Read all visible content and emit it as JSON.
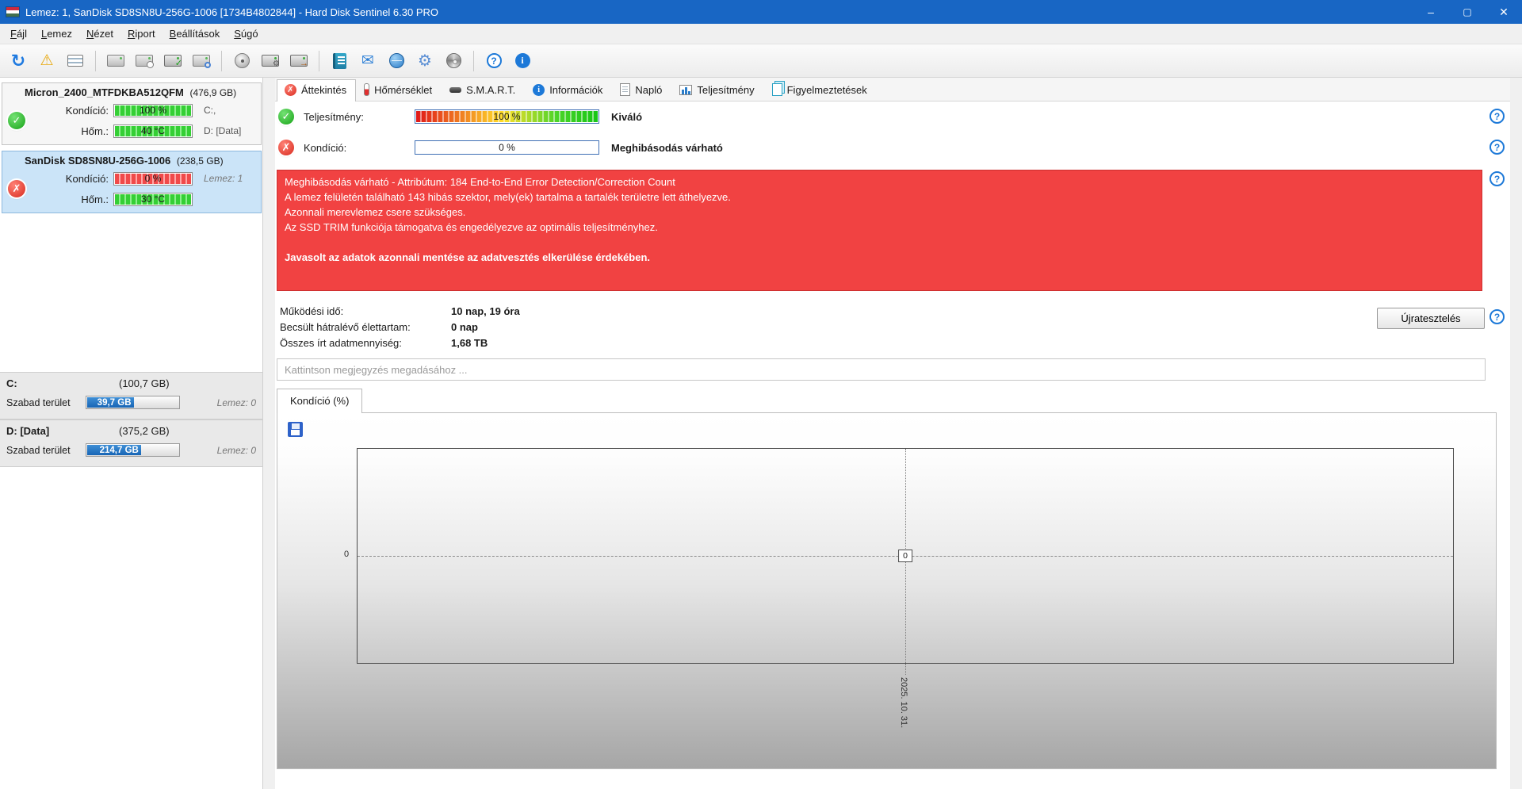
{
  "window": {
    "title": "Lemez: 1, SanDisk SD8SN8U-256G-1006 [1734B4802844]  -  Hard Disk Sentinel 6.30 PRO",
    "controls": [
      "minimize",
      "maximize",
      "close"
    ]
  },
  "menu": {
    "items": [
      "Fájl",
      "Lemez",
      "Nézet",
      "Riport",
      "Beállítások",
      "Súgó"
    ]
  },
  "toolbar": {
    "icons": [
      "refresh",
      "disk-warning",
      "report",
      "disk-test",
      "disk-seek",
      "disk-ok",
      "disk-search",
      "disk-platter",
      "disk-gear",
      "disk-exit",
      "notebook",
      "email",
      "network-disk",
      "settings",
      "cd",
      "help",
      "info"
    ]
  },
  "sidebar": {
    "disks": [
      {
        "name": "Micron_2400_MTFDKBA512QFM",
        "size": "(476,9 GB)",
        "status": "ok",
        "condition_label": "Kondíció:",
        "condition_value": "100 %",
        "temp_label": "Hőm.:",
        "temp_value": "40 °C",
        "right1": "C:,",
        "right2": "D: [Data]"
      },
      {
        "name": "SanDisk SD8SN8U-256G-1006",
        "size": "(238,5 GB)",
        "status": "fail",
        "condition_label": "Kondíció:",
        "condition_value": "0 %",
        "temp_label": "Hőm.:",
        "temp_value": "30 °C",
        "right1": "Lemez: 1",
        "right2": ""
      }
    ],
    "partitions": [
      {
        "name": "C:",
        "size": "(100,7 GB)",
        "free_label": "Szabad terület",
        "free_value": "39,7 GB",
        "disk": "Lemez: 0"
      },
      {
        "name": "D: [Data]",
        "size": "(375,2 GB)",
        "free_label": "Szabad terület",
        "free_value": "214,7 GB",
        "disk": "Lemez: 0"
      }
    ]
  },
  "tabs": [
    {
      "label": "Áttekintés"
    },
    {
      "label": "Hőmérséklet"
    },
    {
      "label": "S.M.A.R.T."
    },
    {
      "label": "Információk"
    },
    {
      "label": "Napló"
    },
    {
      "label": "Teljesítmény"
    },
    {
      "label": "Figyelmeztetések"
    }
  ],
  "overview": {
    "performance_label": "Teljesítmény:",
    "performance_value": "100 %",
    "performance_text": "Kiváló",
    "condition_label": "Kondíció:",
    "condition_value": "0 %",
    "condition_text": "Meghibásodás várható",
    "alert_lines": [
      "Meghibásodás várható - Attribútum: 184 End-to-End Error Detection/Correction Count",
      "A lemez felületén található 143 hibás szektor, mely(ek) tartalma a tartalék területre lett áthelyezve.",
      "Azonnali merevlemez csere szükséges.",
      "Az SSD TRIM funkciója támogatva és engedélyezve az optimális teljesítményhez."
    ],
    "alert_bold": "Javasolt az adatok azonnali mentése az adatvesztés elkerülése érdekében.",
    "stats": [
      {
        "label": "Működési idő:",
        "value": "10 nap, 19 óra"
      },
      {
        "label": "Becsült hátralévő élettartam:",
        "value": "0 nap"
      },
      {
        "label": "Összes írt adatmennyiség:",
        "value": "1,68 TB"
      }
    ],
    "retest_button": "Újratesztelés",
    "comment_placeholder": "Kattintson megjegyzés megadásához ...",
    "chart_tab_label": "Kondíció  (%)"
  },
  "chart_data": {
    "type": "line",
    "title": "Kondíció (%)",
    "x": [
      "2025. 10. 31."
    ],
    "series": [
      {
        "name": "Kondíció",
        "values": [
          0
        ]
      }
    ],
    "ytick_labels": [
      "0"
    ],
    "point_label": "0",
    "ylabel": "",
    "xlabel": "",
    "legend": false,
    "grid": "dashed crosshair at data point"
  },
  "colors": {
    "titlebar": "#1866c4",
    "alert_bg": "#f14242",
    "ok_green": "#17a317",
    "fail_red": "#d82a1e",
    "free_bar_blue": "#1765b5",
    "help_blue": "#1d79d8"
  }
}
